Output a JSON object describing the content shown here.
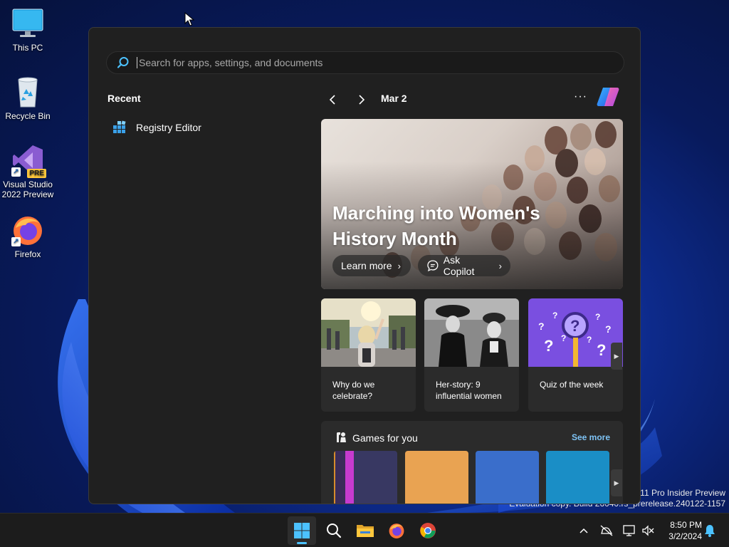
{
  "desktop": {
    "icons": [
      {
        "label": "This PC"
      },
      {
        "label": "Recycle Bin"
      },
      {
        "label": "Visual Studio 2022 Preview",
        "line1": "Visual Studio",
        "line2": "2022 Preview",
        "badge": "PRE"
      },
      {
        "label": "Firefox"
      }
    ],
    "watermark": {
      "line1": "s 11 Pro Insider Preview",
      "line2": "Evaluation copy. Build 26040.rs_prerelease.240122-1157"
    }
  },
  "start_menu": {
    "search": {
      "placeholder": "Search for apps, settings, and documents",
      "value": ""
    },
    "recent": {
      "title": "Recent",
      "items": [
        {
          "label": "Registry Editor",
          "icon": "registry-editor-icon"
        }
      ]
    },
    "widgets": {
      "date": "Mar 2",
      "more_label": "···",
      "hero": {
        "title": "Marching into Women's History Month",
        "learn_more": "Learn more",
        "ask_copilot": "Ask Copilot"
      },
      "cards": [
        {
          "text": "Why do we celebrate?"
        },
        {
          "text": "Her-story: 9 influential women"
        },
        {
          "text": "Quiz of the week"
        }
      ],
      "games": {
        "title": "Games for you",
        "see_more": "See more",
        "tile_colors": [
          "#383862",
          "#e9a352",
          "#3a6ecb",
          "#1a8ec6"
        ]
      }
    }
  },
  "taskbar": {
    "apps": [
      "start-icon",
      "search-icon",
      "file-explorer-icon",
      "firefox-icon",
      "chrome-icon"
    ],
    "clock": {
      "time": "8:50 PM",
      "date": "3/2/2024"
    }
  },
  "colors": {
    "accent": "#4cc2ff",
    "link": "#7ec3f5",
    "menu_bg": "#202020",
    "card_bg": "#2b2b2b",
    "taskbar_bg": "#1c1c1c"
  }
}
